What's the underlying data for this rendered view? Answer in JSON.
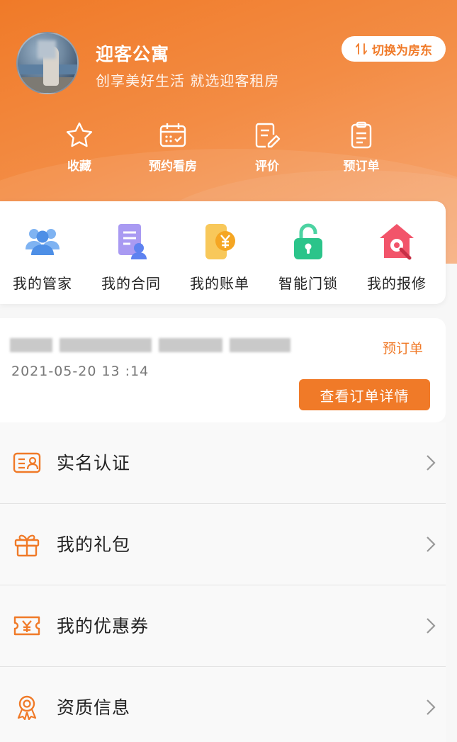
{
  "header": {
    "brand_name": "迎客公寓",
    "slogan": "创享美好生活 就选迎客租房",
    "switch_label": "切换为房东",
    "accent_color": "#f07a28",
    "quick_actions": [
      {
        "label": "收藏",
        "icon": "star-icon"
      },
      {
        "label": "预约看房",
        "icon": "calendar-icon"
      },
      {
        "label": "评价",
        "icon": "edit-note-icon"
      },
      {
        "label": "预订单",
        "icon": "clipboard-icon"
      }
    ]
  },
  "services": [
    {
      "label": "我的管家",
      "icon": "people-group-icon"
    },
    {
      "label": "我的合同",
      "icon": "contract-icon"
    },
    {
      "label": "我的账单",
      "icon": "bill-yen-icon"
    },
    {
      "label": "智能门锁",
      "icon": "smart-lock-icon"
    },
    {
      "label": "我的报修",
      "icon": "repair-house-icon"
    }
  ],
  "order": {
    "type": "预订单",
    "time": "2021-05-20 13 :14",
    "detail_button": "查看订单详情"
  },
  "menu": [
    {
      "label": "实名认证",
      "icon": "id-card-icon"
    },
    {
      "label": "我的礼包",
      "icon": "gift-icon"
    },
    {
      "label": "我的优惠券",
      "icon": "coupon-icon"
    },
    {
      "label": "资质信息",
      "icon": "award-icon"
    }
  ]
}
